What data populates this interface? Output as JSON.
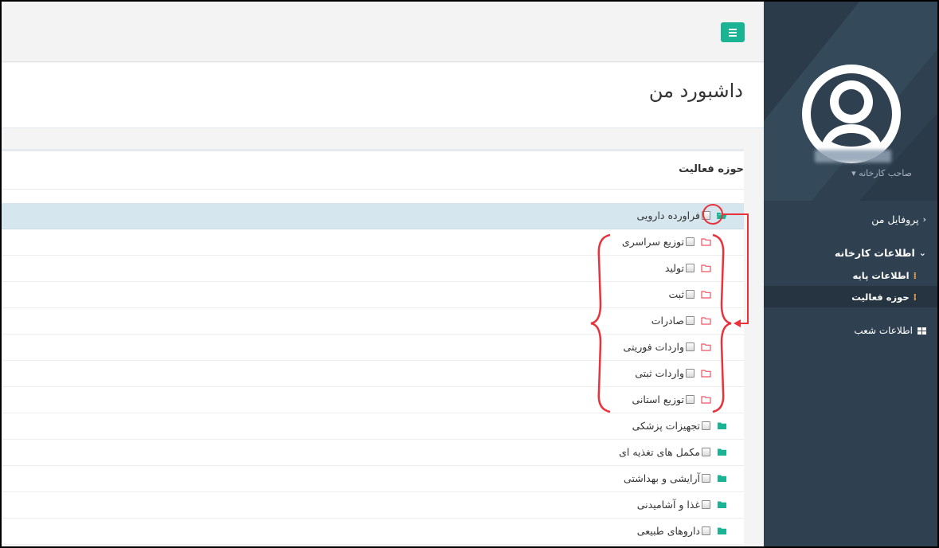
{
  "app": {
    "page_title": "داشبورد من",
    "menu_button": "hamburger-menu"
  },
  "sidebar": {
    "role_label": "صاحب کارخانه ▾",
    "items": [
      {
        "label": "پروفایل من",
        "icon": "chevron-left-icon"
      },
      {
        "label": "اطلاعات کارخانه",
        "icon": "chevron-down-icon"
      },
      {
        "label": "اطلاعات پایه",
        "icon": "dots-icon"
      },
      {
        "label": "حوزه فعالیت",
        "icon": "dots-icon"
      },
      {
        "label": "اطلاعات شعب",
        "icon": "grid-icon"
      }
    ]
  },
  "panel": {
    "title": "حوزه فعالیت",
    "tree": [
      {
        "label": "فراورده دارویی",
        "level": 0,
        "icon": "folder-open-icon",
        "highlighted": true
      },
      {
        "label": "توزیع سراسری",
        "level": 1,
        "icon": "folder-outline-icon"
      },
      {
        "label": "تولید",
        "level": 1,
        "icon": "folder-outline-icon"
      },
      {
        "label": "ثبت",
        "level": 1,
        "icon": "folder-outline-icon"
      },
      {
        "label": "صادرات",
        "level": 1,
        "icon": "folder-outline-icon"
      },
      {
        "label": "واردات فوریتی",
        "level": 1,
        "icon": "folder-outline-icon"
      },
      {
        "label": "واردات ثبتی",
        "level": 1,
        "icon": "folder-outline-icon"
      },
      {
        "label": "توزیع استانی",
        "level": 1,
        "icon": "folder-outline-icon"
      },
      {
        "label": "تجهیزات پزشکی",
        "level": 0,
        "icon": "folder-filled-icon"
      },
      {
        "label": "مکمل های تغذیه ای",
        "level": 0,
        "icon": "folder-filled-icon"
      },
      {
        "label": "آرایشی و بهداشتی",
        "level": 0,
        "icon": "folder-filled-icon"
      },
      {
        "label": "غذا و آشامیدنی",
        "level": 0,
        "icon": "folder-filled-icon"
      },
      {
        "label": "داروهای طبیعی",
        "level": 0,
        "icon": "folder-filled-icon"
      }
    ]
  },
  "colors": {
    "sidebar_bg": "#2f4050",
    "accent": "#1ab394",
    "highlight_row": "#d6e6ef",
    "annotation": "#e8323c",
    "subfolder": "#ed5565"
  }
}
